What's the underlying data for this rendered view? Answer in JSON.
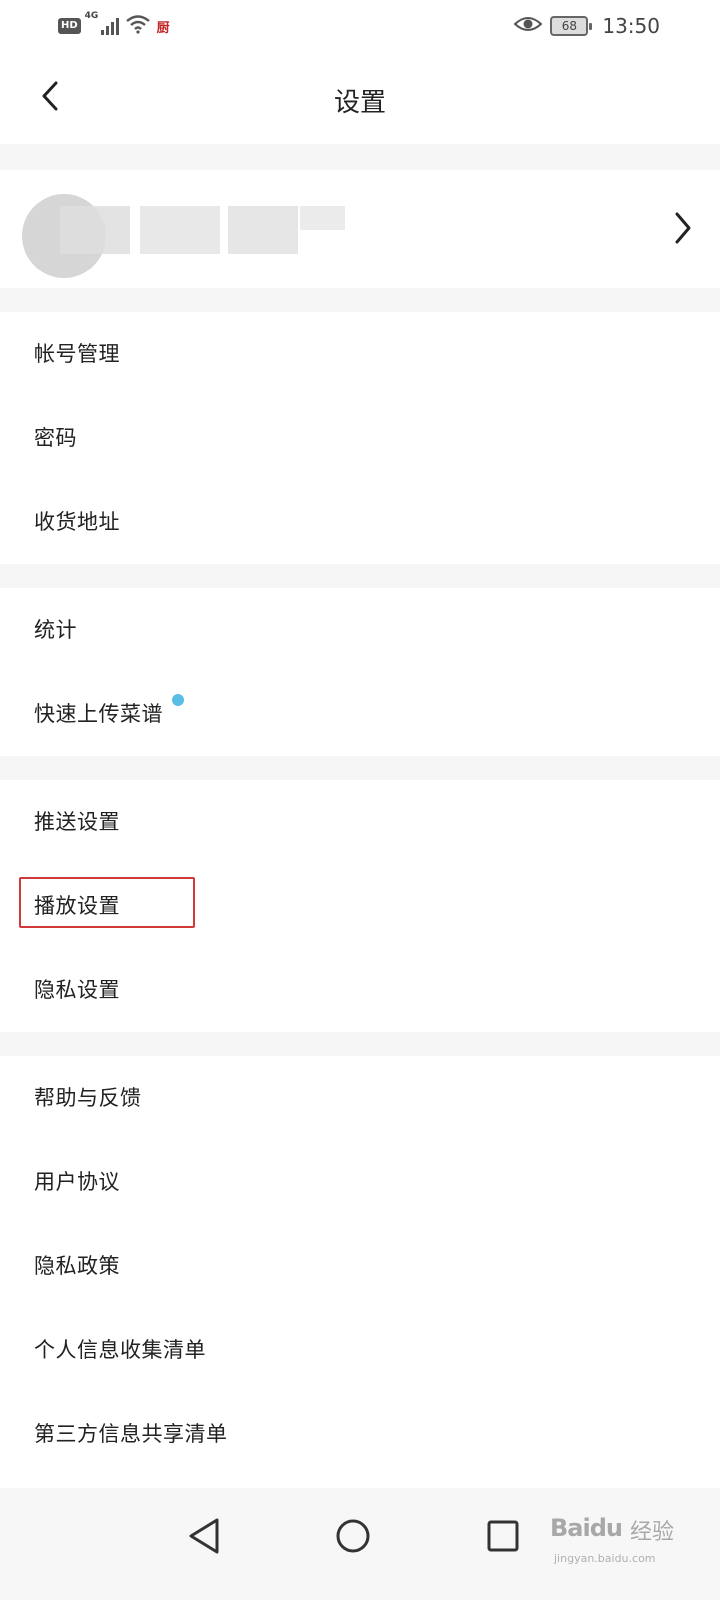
{
  "status_bar": {
    "hd_label": "HD",
    "network_label": "4G",
    "app_badge": "厨",
    "battery_level": "68",
    "time": "13:50"
  },
  "header": {
    "title": "设置"
  },
  "sections": [
    {
      "items": [
        "帐号管理",
        "密码",
        "收货地址"
      ]
    },
    {
      "items": [
        "统计",
        "快速上传菜谱"
      ]
    },
    {
      "items": [
        "推送设置",
        "播放设置",
        "隐私设置"
      ]
    },
    {
      "items": [
        "帮助与反馈",
        "用户协议",
        "隐私政策",
        "个人信息收集清单",
        "第三方信息共享清单"
      ]
    }
  ],
  "watermark": {
    "brand": "Baidu",
    "brand_cn": "经验",
    "url": "jingyan.baidu.com"
  },
  "colors": {
    "highlight": "#d23a3a",
    "notify_dot": "#5bbde4",
    "section_gap": "#f6f6f6"
  }
}
